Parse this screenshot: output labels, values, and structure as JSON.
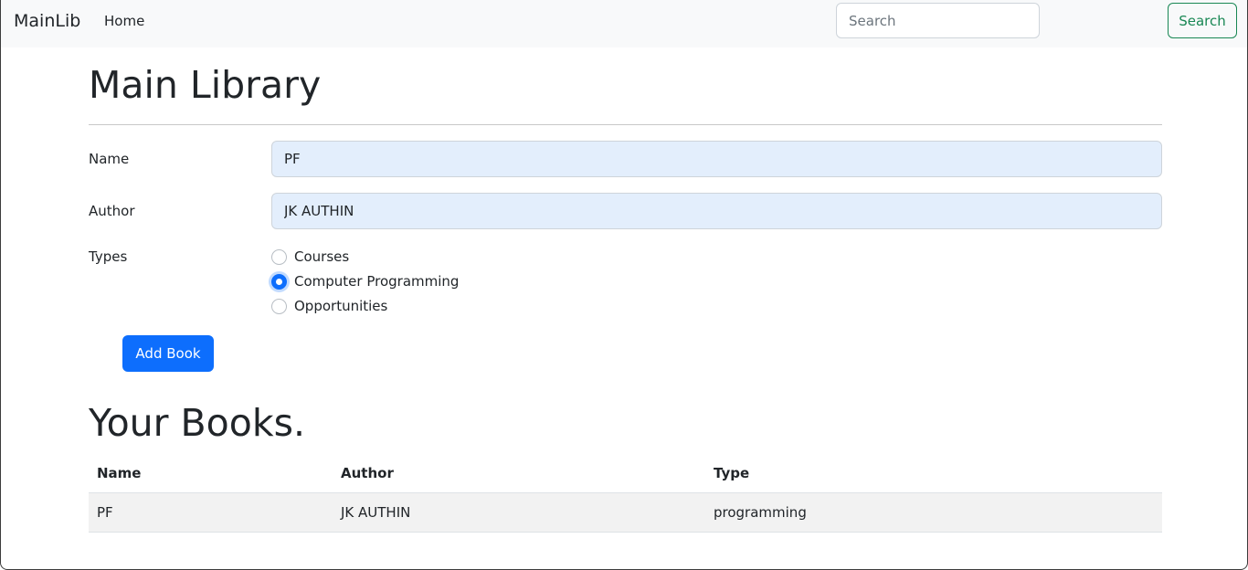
{
  "navbar": {
    "brand": "MainLib",
    "home_link": "Home",
    "search_placeholder": "Search",
    "search_button": "Search"
  },
  "main": {
    "title": "Main Library",
    "form": {
      "name_label": "Name",
      "name_value": "PF",
      "author_label": "Author",
      "author_value": "JK AUTHIN",
      "types_label": "Types",
      "types": [
        {
          "label": "Courses",
          "checked": false
        },
        {
          "label": "Computer Programming",
          "checked": true
        },
        {
          "label": "Opportunities",
          "checked": false
        }
      ],
      "add_button": "Add Book"
    },
    "books_title": "Your Books.",
    "table": {
      "headers": [
        "Name",
        "Author",
        "Type"
      ],
      "rows": [
        [
          "PF",
          "JK AUTHIN",
          "programming"
        ]
      ]
    }
  },
  "colors": {
    "primary": "#0d6efd",
    "success": "#198754",
    "navbar_bg": "#f8f9fa",
    "autofill_bg": "#e3eefc"
  }
}
